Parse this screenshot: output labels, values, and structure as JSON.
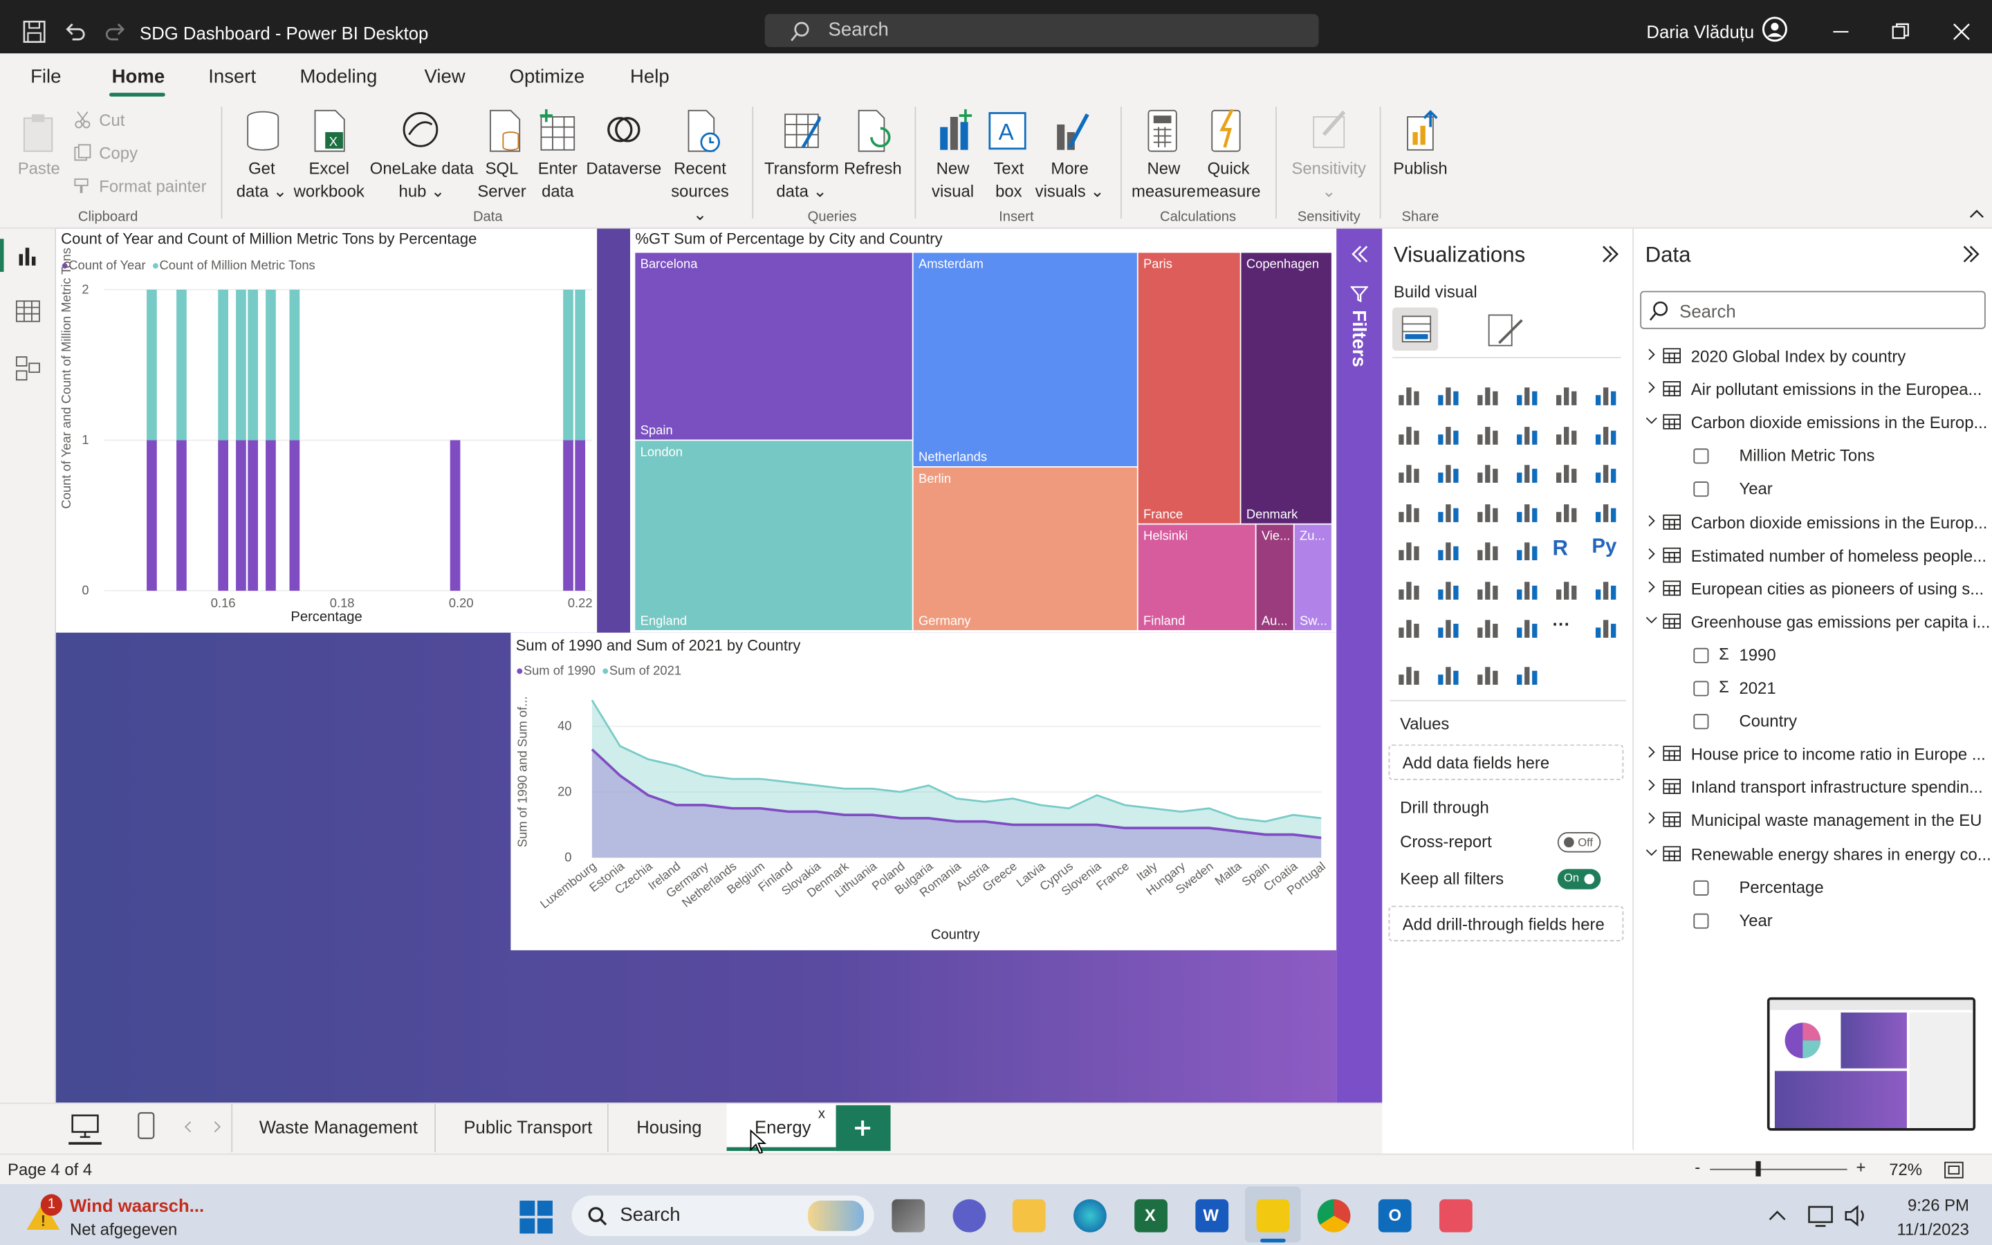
{
  "window": {
    "title": "SDG Dashboard - Power BI Desktop",
    "search_placeholder": "Search",
    "user": "Daria Vlăduțu"
  },
  "menu": [
    "File",
    "Home",
    "Insert",
    "Modeling",
    "View",
    "Optimize",
    "Help"
  ],
  "ribbon": {
    "clipboard": {
      "paste": "Paste",
      "cut": "Cut",
      "copy": "Copy",
      "format_painter": "Format painter",
      "group": "Clipboard"
    },
    "data": {
      "get_data": [
        "Get",
        "data"
      ],
      "excel": [
        "Excel",
        "workbook"
      ],
      "onelake": [
        "OneLake data",
        "hub"
      ],
      "sql": [
        "SQL",
        "Server"
      ],
      "enter": [
        "Enter",
        "data"
      ],
      "dataverse": "Dataverse",
      "recent": [
        "Recent",
        "sources"
      ],
      "group": "Data"
    },
    "queries": {
      "transform": [
        "Transform",
        "data"
      ],
      "refresh": "Refresh",
      "group": "Queries"
    },
    "insert": {
      "new_visual": [
        "New",
        "visual"
      ],
      "text_box": [
        "Text",
        "box"
      ],
      "more_visuals": [
        "More",
        "visuals"
      ],
      "group": "Insert"
    },
    "calculations": {
      "new_measure": [
        "New",
        "measure"
      ],
      "quick_measure": [
        "Quick",
        "measure"
      ],
      "group": "Calculations"
    },
    "sensitivity": {
      "label": "Sensitivity",
      "group": "Sensitivity"
    },
    "share": {
      "publish": "Publish",
      "group": "Share"
    }
  },
  "visual1": {
    "title": "Count of Year and Count of Million Metric Tons by Percentage",
    "legend": [
      "Count of Year",
      "Count of Million Metric Tons"
    ],
    "ylabel": "Count of Year and Count of Million Metric Tons",
    "xlabel": "Percentage",
    "yticks": [
      "0",
      "1",
      "2"
    ],
    "xticks": [
      "0.16",
      "0.18",
      "0.20",
      "0.22"
    ]
  },
  "visual2": {
    "title": "%GT Sum of Percentage by City and Country",
    "tiles": [
      {
        "city": "Barcelona",
        "country": "Spain",
        "color": "#7a50c0"
      },
      {
        "city": "London",
        "country": "England",
        "color": "#76c8c4"
      },
      {
        "city": "Amsterdam",
        "country": "Netherlands",
        "color": "#5b8ef2"
      },
      {
        "city": "Berlin",
        "country": "Germany",
        "color": "#ef9a7d"
      },
      {
        "city": "Paris",
        "country": "France",
        "color": "#dd5d5a"
      },
      {
        "city": "Copenhagen",
        "country": "Denmark",
        "color": "#5a2672"
      },
      {
        "city": "Helsinki",
        "country": "Finland",
        "color": "#d65c9d"
      },
      {
        "city": "Vie...",
        "country": "Au...",
        "color": "#9b3c7e"
      },
      {
        "city": "Zu...",
        "country": "Sw...",
        "color": "#b183e9"
      }
    ]
  },
  "visual3": {
    "title": "Sum of 1990 and Sum of 2021 by Country",
    "legend": [
      "Sum of 1990",
      "Sum of 2021"
    ],
    "ylabel": "Sum of 1990 and Sum of...",
    "xlabel": "Country",
    "yticks": [
      "0",
      "20",
      "40"
    ]
  },
  "chart_data": [
    {
      "type": "bar",
      "title": "Count of Year and Count of Million Metric Tons by Percentage",
      "xlabel": "Percentage",
      "ylabel": "Count of Year and Count of Million Metric Tons",
      "ylim": [
        0,
        2
      ],
      "x": [
        0.148,
        0.153,
        0.16,
        0.163,
        0.165,
        0.168,
        0.172,
        0.199,
        0.218,
        0.22
      ],
      "series": [
        {
          "name": "Count of Year",
          "values": [
            1,
            1,
            1,
            1,
            1,
            1,
            1,
            1,
            1,
            1
          ]
        },
        {
          "name": "Count of Million Metric Tons",
          "values": [
            1,
            1,
            1,
            1,
            1,
            1,
            1,
            0,
            1,
            1
          ]
        }
      ]
    },
    {
      "type": "area",
      "title": "Sum of 1990 and Sum of 2021 by Country",
      "xlabel": "Country",
      "ylabel": "Sum of 1990 and Sum of...",
      "ylim": [
        0,
        50
      ],
      "categories": [
        "Luxembourg",
        "Estonia",
        "Czechia",
        "Ireland",
        "Germany",
        "Netherlands",
        "Belgium",
        "Finland",
        "Slovakia",
        "Denmark",
        "Lithuania",
        "Poland",
        "Bulgaria",
        "Romania",
        "Austria",
        "Greece",
        "Latvia",
        "Cyprus",
        "Slovenia",
        "France",
        "Italy",
        "Hungary",
        "Sweden",
        "Malta",
        "Spain",
        "Croatia",
        "Portugal"
      ],
      "series": [
        {
          "name": "Sum of 1990",
          "values": [
            48,
            34,
            30,
            28,
            25,
            24,
            24,
            23,
            22,
            21,
            21,
            20,
            22,
            18,
            17,
            18,
            16,
            15,
            19,
            16,
            15,
            14,
            15,
            12,
            11,
            13,
            12
          ]
        },
        {
          "name": "Sum of 2021",
          "values": [
            33,
            25,
            19,
            16,
            16,
            15,
            15,
            14,
            14,
            13,
            13,
            12,
            12,
            11,
            11,
            10,
            10,
            10,
            10,
            9,
            9,
            9,
            9,
            8,
            7,
            7,
            6
          ]
        }
      ]
    }
  ],
  "filters_label": "Filters",
  "viz_pane": {
    "title": "Visualizations",
    "build_visual": "Build visual",
    "values": "Values",
    "add_data": "Add data fields here",
    "drill_through": "Drill through",
    "cross_report": "Cross-report",
    "cross_report_state": "Off",
    "keep_filters": "Keep all filters",
    "keep_filters_state": "On",
    "add_drill": "Add drill-through fields here"
  },
  "data_pane": {
    "title": "Data",
    "search_placeholder": "Search",
    "rows": [
      {
        "kind": "table",
        "text": "2020 Global Index by country",
        "expanded": false
      },
      {
        "kind": "table",
        "text": "Air pollutant emissions in the Europea...",
        "expanded": false
      },
      {
        "kind": "table",
        "text": "Carbon dioxide emissions in the Europ...",
        "expanded": true
      },
      {
        "kind": "field",
        "text": "Million Metric Tons"
      },
      {
        "kind": "field",
        "text": "Year"
      },
      {
        "kind": "table",
        "text": "Carbon dioxide emissions in the Europ...",
        "expanded": false
      },
      {
        "kind": "table",
        "text": "Estimated number of homeless people...",
        "expanded": false
      },
      {
        "kind": "table",
        "text": "European cities as pioneers of using s...",
        "expanded": false
      },
      {
        "kind": "table",
        "text": "Greenhouse gas emissions per capita i...",
        "expanded": true
      },
      {
        "kind": "sum",
        "text": "1990"
      },
      {
        "kind": "sum",
        "text": "2021"
      },
      {
        "kind": "field",
        "text": "Country"
      },
      {
        "kind": "table",
        "text": "House price to income ratio in Europe ...",
        "expanded": false
      },
      {
        "kind": "table",
        "text": "Inland transport infrastructure spendin...",
        "expanded": false
      },
      {
        "kind": "table",
        "text": "Municipal waste management in the EU",
        "expanded": false
      },
      {
        "kind": "table",
        "text": "Renewable energy shares in energy co...",
        "expanded": true
      },
      {
        "kind": "field",
        "text": "Percentage"
      },
      {
        "kind": "field",
        "text": "Year"
      }
    ]
  },
  "page_tabs": [
    "Waste Management",
    "Public Transport",
    "Housing",
    "Energy"
  ],
  "active_tab": "Energy",
  "status": {
    "page": "Page 4 of 4",
    "zoom": "72%"
  },
  "taskbar": {
    "weather_title": "Wind waarsch...",
    "weather_sub": "Net afgegeven",
    "weather_badge": "1",
    "search": "Search",
    "time": "9:26 PM",
    "date": "11/1/2023"
  },
  "colors": {
    "purple": "#7f4cc2",
    "teal": "#76cbc6",
    "accent": "#7b4fc7",
    "active_tab": "#1a7a5a"
  }
}
